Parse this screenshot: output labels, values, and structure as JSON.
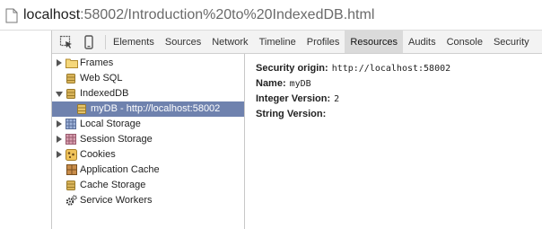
{
  "address_bar": {
    "url_host": "localhost",
    "url_rest": ":58002/Introduction%20to%20IndexedDB.html",
    "page_icon": "document-icon"
  },
  "toolbar": {
    "inspect_icon": "inspect-element-icon",
    "device_icon": "device-mode-icon",
    "tabs": [
      "Elements",
      "Sources",
      "Network",
      "Timeline",
      "Profiles",
      "Resources",
      "Audits",
      "Console",
      "Security"
    ],
    "active_tab": "Resources"
  },
  "sidebar": {
    "items": [
      {
        "label": "Frames",
        "icon": "folder-icon",
        "expander": "collapsed"
      },
      {
        "label": "Web SQL",
        "icon": "database-icon",
        "expander": "none"
      },
      {
        "label": "IndexedDB",
        "icon": "database-icon",
        "expander": "expanded"
      },
      {
        "label": "myDB - http://localhost:58002",
        "icon": "database-icon",
        "expander": "none",
        "selected": true
      },
      {
        "label": "Local Storage",
        "icon": "grid-storage-icon",
        "expander": "collapsed"
      },
      {
        "label": "Session Storage",
        "icon": "grid-storage-icon",
        "expander": "collapsed"
      },
      {
        "label": "Cookies",
        "icon": "cookie-icon",
        "expander": "collapsed"
      },
      {
        "label": "Application Cache",
        "icon": "app-cache-icon",
        "expander": "none"
      },
      {
        "label": "Cache Storage",
        "icon": "database-icon",
        "expander": "none"
      },
      {
        "label": "Service Workers",
        "icon": "gears-icon",
        "expander": "none"
      }
    ]
  },
  "details": {
    "security_origin_label": "Security origin:",
    "security_origin_value": "http://localhost:58002",
    "name_label": "Name:",
    "name_value": "myDB",
    "integer_version_label": "Integer Version:",
    "integer_version_value": "2",
    "string_version_label": "String Version:",
    "string_version_value": ""
  },
  "colors": {
    "selected_row": "#6f82ae",
    "active_tab": "#dadada",
    "toolbar_bg": "#f3f3f3"
  }
}
